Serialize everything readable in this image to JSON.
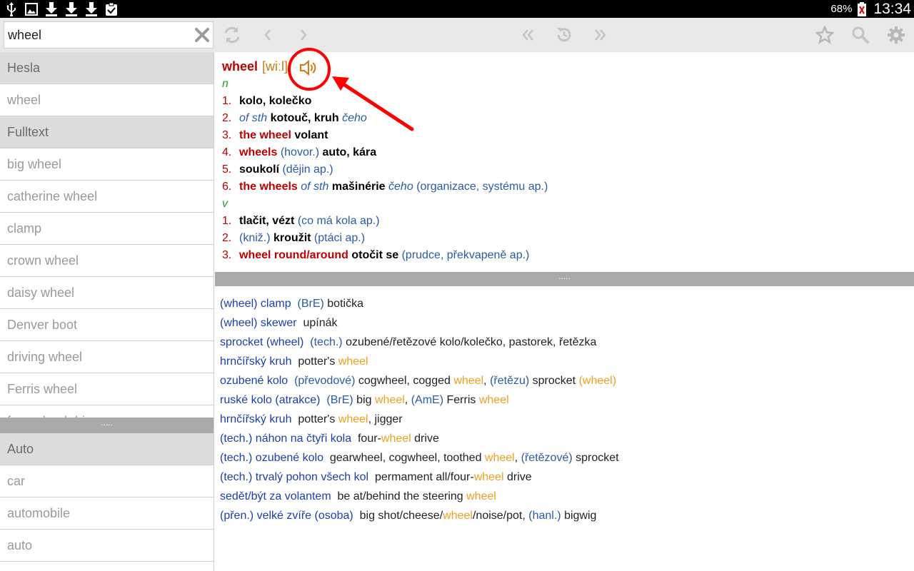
{
  "status_bar": {
    "battery_percent": "68%",
    "time": "13:34",
    "icons": [
      "usb-icon",
      "image-icon",
      "download-icon",
      "download-icon",
      "download-icon",
      "clipboard-check-icon",
      "battery-icon"
    ]
  },
  "search": {
    "value": "wheel"
  },
  "left": {
    "header_hesla": "Hesla",
    "hesla_items": [
      "wheel"
    ],
    "header_fulltext": "Fulltext",
    "fulltext_items": [
      "big wheel",
      "catherine wheel",
      "clamp",
      "crown wheel",
      "daisy wheel",
      "Denver boot",
      "driving wheel",
      "Ferris wheel",
      "four-wheel drive"
    ],
    "divider_dots": ".....",
    "header_lower": "Auto",
    "lower_items": [
      "car",
      "automobile",
      "auto"
    ]
  },
  "entry": {
    "headword": "wheel",
    "pronunciation": "[wiːl]",
    "pos_noun": "n",
    "pos_verb": "v",
    "n": [
      {
        "num": "1.",
        "t1": "kolo, kolečko"
      },
      {
        "num": "2.",
        "pre": "of sth",
        "t1": "kotouč, kruh",
        "post": "čeho"
      },
      {
        "num": "3.",
        "red": "the wheel",
        "t1": "volant"
      },
      {
        "num": "4.",
        "red": "wheels",
        "note": "(hovor.)",
        "t1": "auto, kára"
      },
      {
        "num": "5.",
        "t1": "soukolí",
        "note": "(dějin ap.)"
      },
      {
        "num": "6.",
        "red": "the wheels",
        "pre": "of sth",
        "t1": "mašinérie",
        "post": "čeho",
        "note": "(organizace, systému ap.)"
      }
    ],
    "v": [
      {
        "num": "1.",
        "t1": "tlačit, vézt",
        "note": "(co má kola ap.)"
      },
      {
        "num": "2.",
        "note_pre": "(kniž.)",
        "t1": "kroužit",
        "note": "(ptáci ap.)"
      },
      {
        "num": "3.",
        "red": "wheel round/around",
        "t1": "otočit se",
        "note": "(prudce, překvapeně ap.)"
      }
    ]
  },
  "mid_divider": ".....",
  "results": [
    {
      "src": "(wheel) clamp",
      "note": "(BrE)",
      "t1": "botička"
    },
    {
      "src": "(wheel) skewer",
      "t1": "upínák"
    },
    {
      "src": "sprocket (wheel)",
      "note": "(tech.)",
      "t1": "ozubené/řetězové kolo/kolečko, pastorek, řetězka"
    },
    {
      "src": "hrnčířský kruh",
      "t1": "potter's",
      "hi": "wheel"
    },
    {
      "src": "ozubené kolo",
      "note": "(převodové)",
      "t1": "cogwheel, cogged",
      "hi": "wheel",
      "t2": ",",
      "note2": "(řetězu)",
      "t3": "sprocket",
      "hi2": "(wheel)"
    },
    {
      "src": "ruské kolo (atrakce)",
      "note": "(BrE)",
      "t1": "big",
      "hi": "wheel",
      "t2": ",",
      "note2": "(AmE)",
      "t3": "Ferris",
      "hi2": "wheel"
    },
    {
      "src": "hrnčířský kruh",
      "t1": "potter's",
      "hi": "wheel",
      "t2": ", jigger"
    },
    {
      "src": "(tech.) náhon na čtyři kola",
      "t1": "four-",
      "hi": "wheel",
      "t2": "drive"
    },
    {
      "src": "(tech.) ozubené kolo",
      "t1": "gearwheel, cogwheel, toothed",
      "hi": "wheel",
      "t2": ",",
      "note2": "(řetězové)",
      "t3": "sprocket"
    },
    {
      "src": "(tech.) trvalý pohon všech kol",
      "t1": "permament all/four-",
      "hi": "wheel",
      "t2": "drive"
    },
    {
      "src": "sedět/být za volantem",
      "t1": "be at/behind the steering",
      "hi": "wheel"
    },
    {
      "src": "(přen.) velké zvíře (osoba)",
      "t1": "big shot/cheese/",
      "hi": "wheel",
      "t2": "/noise/pot,",
      "note2": "(hanl.)",
      "t3": "bigwig"
    }
  ],
  "colors": {
    "headword_red": "#c00000",
    "pron_orange": "#d07a10",
    "pos_green": "#21a021",
    "note_blue": "#2a5aa8",
    "result_src_blue": "#1b3fb0",
    "highlight_orange": "#f0a020",
    "annotation_red": "#ff0000"
  }
}
